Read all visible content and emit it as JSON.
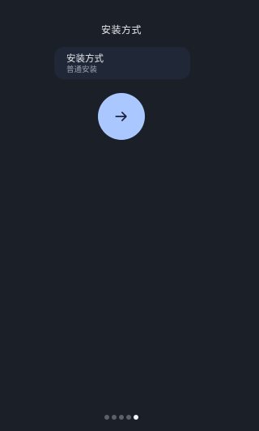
{
  "header": {
    "title": "安装方式"
  },
  "install_option": {
    "title": "安装方式",
    "value": "普通安装"
  },
  "next_button": {
    "icon": "arrow-right-icon"
  },
  "page_indicator": {
    "total": 5,
    "current": 5
  },
  "colors": {
    "background": "#1b1f27",
    "card": "#202838",
    "accent": "#aac7ff",
    "dot_inactive": "#5b616b",
    "dot_active": "#f2f4f7"
  }
}
